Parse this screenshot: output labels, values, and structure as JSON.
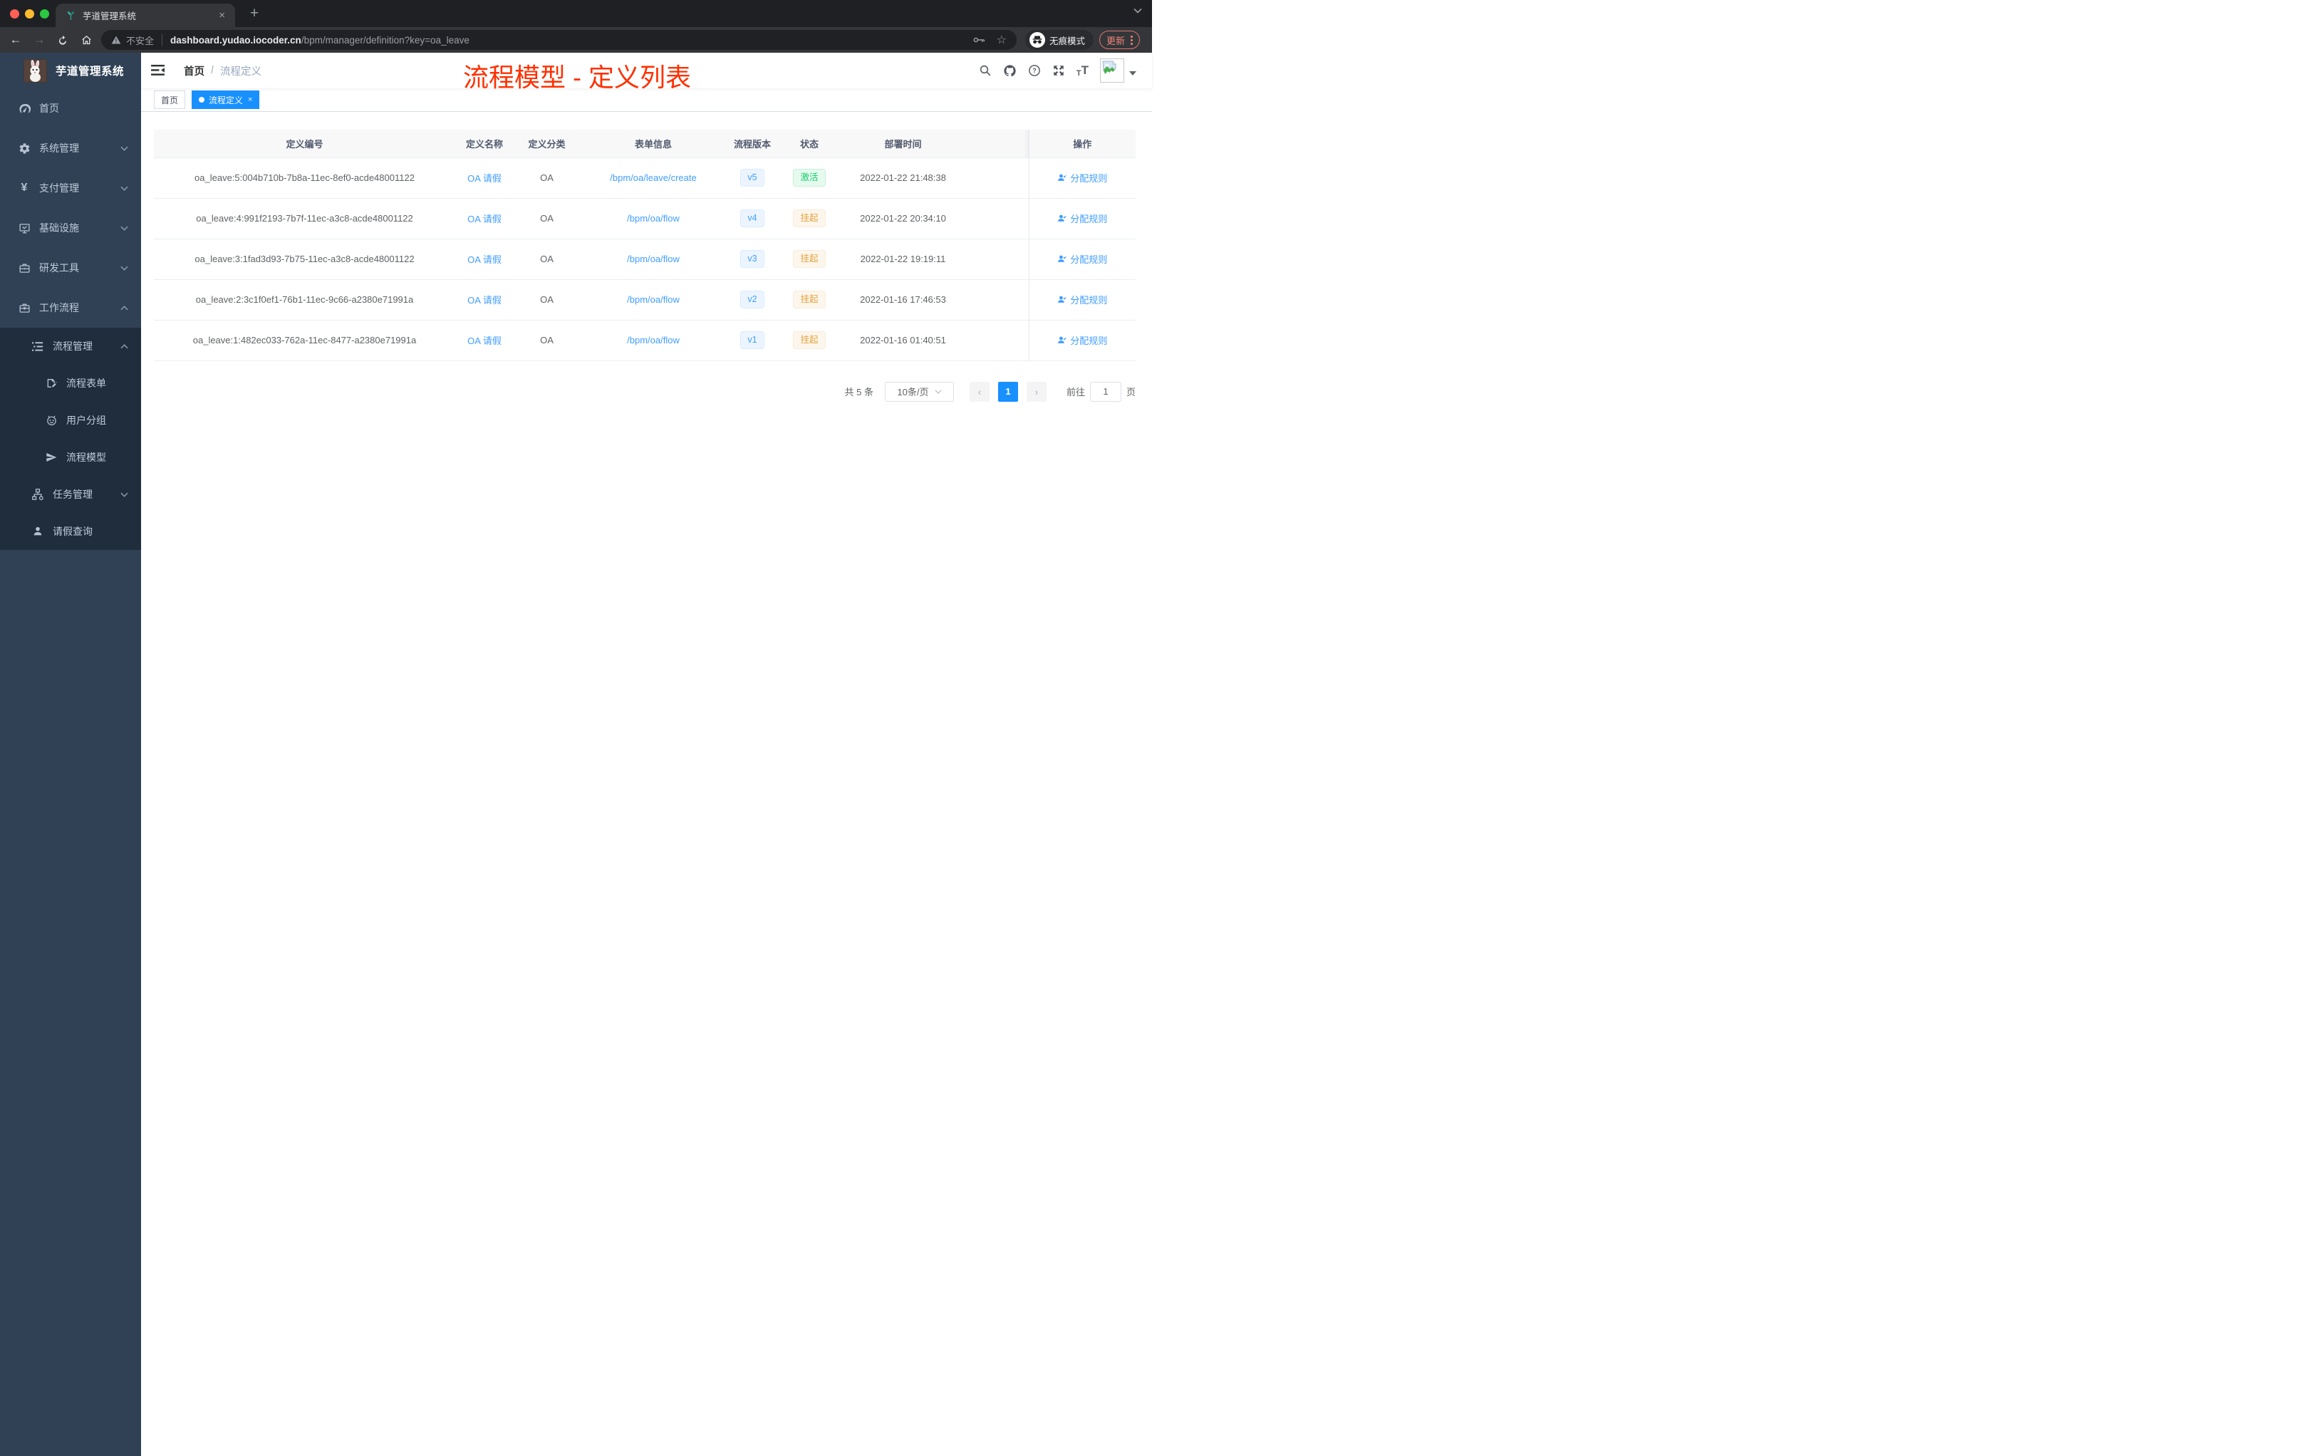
{
  "browser": {
    "tab_title": "芋道管理系统",
    "tab_close": "×",
    "new_tab": "+",
    "address": {
      "security_label": "不安全",
      "host": "dashboard.yudao.iocoder.cn",
      "path": "/bpm/manager/definition?key=oa_leave"
    },
    "incognito_label": "无痕模式",
    "update_label": "更新"
  },
  "sidebar": {
    "logo_title": "芋道管理系统",
    "items": [
      {
        "label": "首页"
      },
      {
        "label": "系统管理"
      },
      {
        "label": "支付管理"
      },
      {
        "label": "基础设施"
      },
      {
        "label": "研发工具"
      },
      {
        "label": "工作流程"
      }
    ],
    "workflow": {
      "process_mgmt": {
        "label": "流程管理",
        "children": [
          {
            "label": "流程表单"
          },
          {
            "label": "用户分组"
          },
          {
            "label": "流程模型"
          }
        ]
      },
      "task_mgmt": {
        "label": "任务管理"
      },
      "leave_query": {
        "label": "请假查询"
      }
    }
  },
  "navbar": {
    "breadcrumb": {
      "home": "首页",
      "sep": "/",
      "current": "流程定义"
    },
    "annotation": {
      "text": "流程模型 - 定义列表",
      "color": "#ff3000"
    }
  },
  "tags": {
    "items": [
      {
        "label": "首页",
        "active": false
      },
      {
        "label": "流程定义",
        "active": true,
        "close": "×"
      }
    ]
  },
  "table": {
    "headers": [
      "定义编号",
      "定义名称",
      "定义分类",
      "表单信息",
      "流程版本",
      "状态",
      "部署时间",
      "操作"
    ],
    "action_label": "分配规则",
    "rows": [
      {
        "id": "oa_leave:5:004b710b-7b8a-11ec-8ef0-acde48001122",
        "name": "OA 请假",
        "category": "OA",
        "form": "/bpm/oa/leave/create",
        "version": "v5",
        "status": {
          "label": "激活",
          "state": "active"
        },
        "deployed_at": "2022-01-22 21:48:38",
        "action": "分配规则"
      },
      {
        "id": "oa_leave:4:991f2193-7b7f-11ec-a3c8-acde48001122",
        "name": "OA 请假",
        "category": "OA",
        "form": "/bpm/oa/flow",
        "version": "v4",
        "status": {
          "label": "挂起",
          "state": "suspended"
        },
        "deployed_at": "2022-01-22 20:34:10",
        "action": "分配规则"
      },
      {
        "id": "oa_leave:3:1fad3d93-7b75-11ec-a3c8-acde48001122",
        "name": "OA 请假",
        "category": "OA",
        "form": "/bpm/oa/flow",
        "version": "v3",
        "status": {
          "label": "挂起",
          "state": "suspended"
        },
        "deployed_at": "2022-01-22 19:19:11",
        "action": "分配规则"
      },
      {
        "id": "oa_leave:2:3c1f0ef1-76b1-11ec-9c66-a2380e71991a",
        "name": "OA 请假",
        "category": "OA",
        "form": "/bpm/oa/flow",
        "version": "v2",
        "status": {
          "label": "挂起",
          "state": "suspended"
        },
        "deployed_at": "2022-01-16 17:46:53",
        "action": "分配规则"
      },
      {
        "id": "oa_leave:1:482ec033-762a-11ec-8477-a2380e71991a",
        "name": "OA 请假",
        "category": "OA",
        "form": "/bpm/oa/flow",
        "version": "v1",
        "status": {
          "label": "挂起",
          "state": "suspended"
        },
        "deployed_at": "2022-01-16 01:40:51",
        "action": "分配规则"
      }
    ]
  },
  "pagination": {
    "total_label": "共 5 条",
    "page_size": "10条/页",
    "prev": "‹",
    "next": "›",
    "current_page": "1",
    "goto_label": "前往",
    "goto_value": "1",
    "page_unit": "页"
  },
  "colors": {
    "accent_blue": "#1890ff",
    "link_blue": "#409eff",
    "success_green": "#13ce66",
    "warning_orange": "#e6a23c",
    "annotation_red": "#ff3000",
    "sidebar_bg": "#304156",
    "submenu_bg": "#1f2d3d"
  }
}
